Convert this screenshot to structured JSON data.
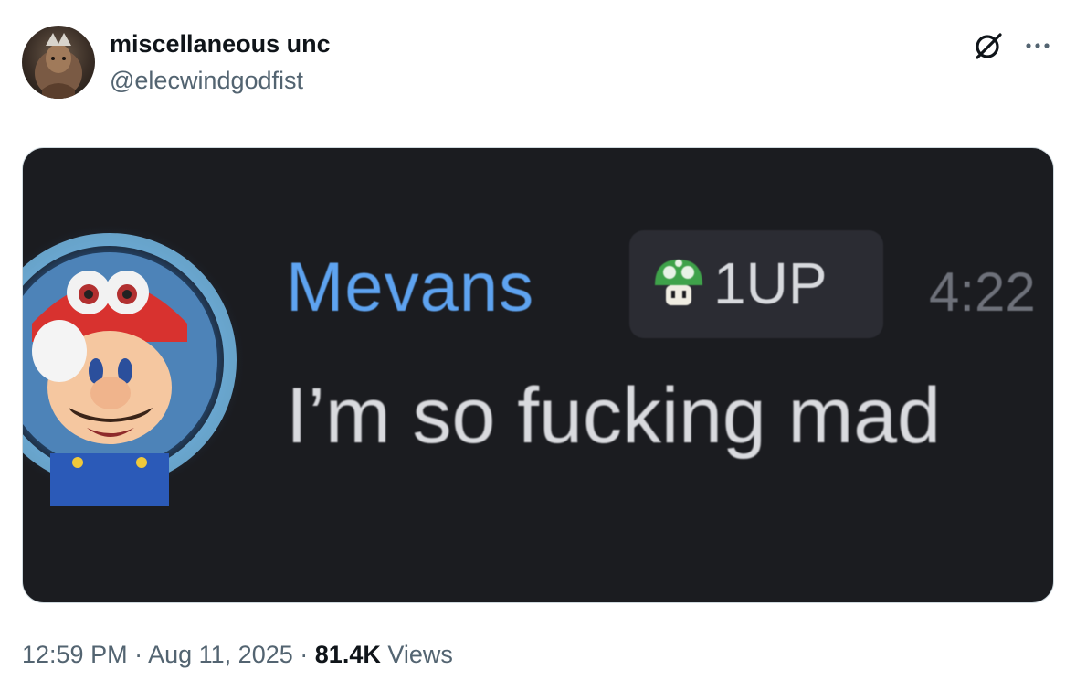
{
  "tweet": {
    "author": {
      "display_name": "miscellaneous unc",
      "handle": "@elecwindgodfist",
      "avatar_icon": "avatar-image"
    },
    "actions": {
      "grok_icon": "grok-icon",
      "more_icon": "more-options-icon"
    },
    "media": {
      "discord_message": {
        "username": "Mevans",
        "username_color": "#5ea3f0",
        "badge_icon": "mushroom-icon",
        "badge_label": "1UP",
        "timestamp": "4:22",
        "message": "I’m so fucking mad"
      }
    },
    "meta": {
      "time": "12:59 PM",
      "separator": "·",
      "date": "Aug 11, 2025",
      "views_count": "81.4K",
      "views_label": "Views"
    }
  }
}
